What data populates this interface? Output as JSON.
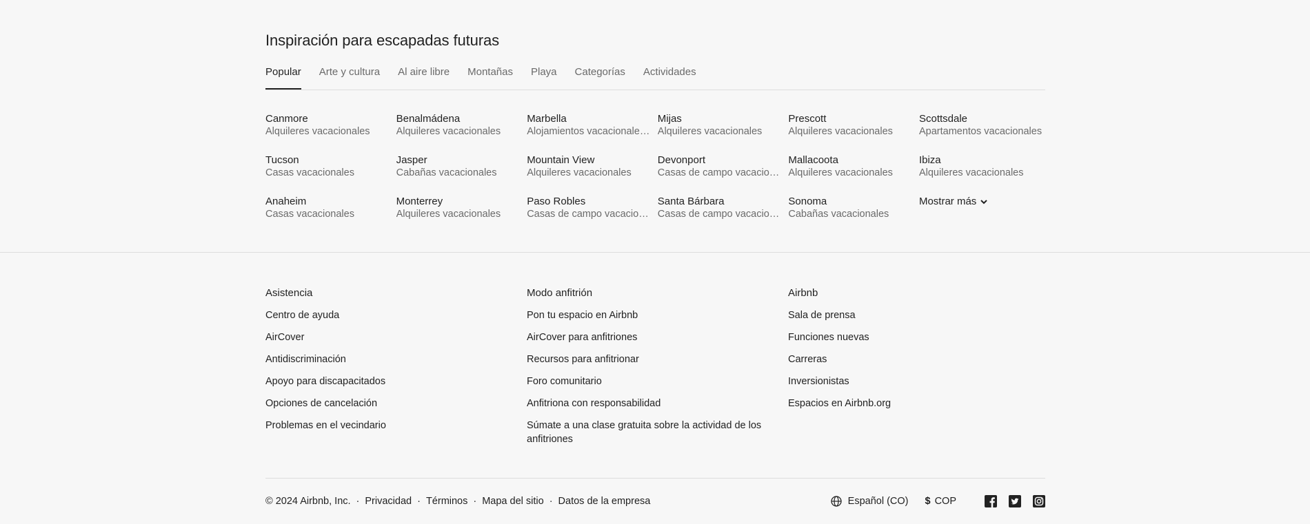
{
  "inspiration": {
    "title": "Inspiración para escapadas futuras",
    "tabs": [
      "Popular",
      "Arte y cultura",
      "Al aire libre",
      "Montañas",
      "Playa",
      "Categorías",
      "Actividades"
    ],
    "destinations": [
      {
        "name": "Canmore",
        "sub": "Alquileres vacacionales"
      },
      {
        "name": "Benalmádena",
        "sub": "Alquileres vacacionales"
      },
      {
        "name": "Marbella",
        "sub": "Alojamientos vacacionales..."
      },
      {
        "name": "Mijas",
        "sub": "Alquileres vacacionales"
      },
      {
        "name": "Prescott",
        "sub": "Alquileres vacacionales"
      },
      {
        "name": "Scottsdale",
        "sub": "Apartamentos vacacionales"
      },
      {
        "name": "Tucson",
        "sub": "Casas vacacionales"
      },
      {
        "name": "Jasper",
        "sub": "Cabañas vacacionales"
      },
      {
        "name": "Mountain View",
        "sub": "Alquileres vacacionales"
      },
      {
        "name": "Devonport",
        "sub": "Casas de campo vacacion..."
      },
      {
        "name": "Mallacoota",
        "sub": "Alquileres vacacionales"
      },
      {
        "name": "Ibiza",
        "sub": "Alquileres vacacionales"
      },
      {
        "name": "Anaheim",
        "sub": "Casas vacacionales"
      },
      {
        "name": "Monterrey",
        "sub": "Alquileres vacacionales"
      },
      {
        "name": "Paso Robles",
        "sub": "Casas de campo vacacion..."
      },
      {
        "name": "Santa Bárbara",
        "sub": "Casas de campo vacacion..."
      },
      {
        "name": "Sonoma",
        "sub": "Cabañas vacacionales"
      }
    ],
    "show_more": "Mostrar más"
  },
  "footer": {
    "columns": [
      {
        "heading": "Asistencia",
        "links": [
          "Centro de ayuda",
          "AirCover",
          "Antidiscriminación",
          "Apoyo para discapacitados",
          "Opciones de cancelación",
          "Problemas en el vecindario"
        ]
      },
      {
        "heading": "Modo anfitrión",
        "links": [
          "Pon tu espacio en Airbnb",
          "AirCover para anfitriones",
          "Recursos para anfitrionar",
          "Foro comunitario",
          "Anfitriona con responsabilidad",
          "Súmate a una clase gratuita sobre la actividad de los anfitriones"
        ]
      },
      {
        "heading": "Airbnb",
        "links": [
          "Sala de prensa",
          "Funciones nuevas",
          "Carreras",
          "Inversionistas",
          "Espacios en Airbnb.org"
        ]
      }
    ],
    "copyright": "© 2024 Airbnb, Inc.",
    "separator": "·",
    "legal_links": [
      "Privacidad",
      "Términos",
      "Mapa del sitio",
      "Datos de la empresa"
    ],
    "language": "Español (CO)",
    "currency_symbol": "$",
    "currency": "COP",
    "social_icons": [
      "facebook-icon",
      "twitter-icon",
      "instagram-icon"
    ]
  }
}
